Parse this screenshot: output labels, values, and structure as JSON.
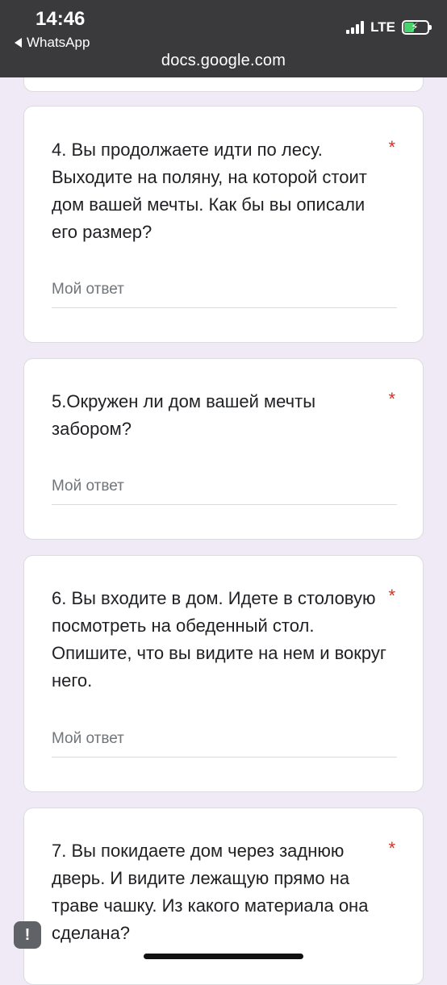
{
  "status_bar": {
    "time": "14:46",
    "back_label": "WhatsApp",
    "network": "LTE"
  },
  "browser": {
    "url": "docs.google.com"
  },
  "questions": [
    {
      "text": "4. Вы продолжаете идти по лесу. Выходите на поляну, на которой стоит дом вашей мечты. Как бы вы описали его размер?",
      "required_mark": "*",
      "answer_placeholder": "Мой ответ"
    },
    {
      "text": "5.Окружен ли дом вашей мечты забором?",
      "required_mark": "*",
      "answer_placeholder": "Мой ответ"
    },
    {
      "text": "6. Вы входите в дом. Идете в столовую посмотреть на обеденный стол. Опишите, что вы видите на нем и вокруг него.",
      "required_mark": "*",
      "answer_placeholder": "Мой ответ"
    },
    {
      "text": "7. Вы покидаете дом через заднюю дверь. И видите лежащую прямо на траве чашку. Из какого материала она сделана?",
      "required_mark": "*",
      "answer_placeholder": ""
    }
  ],
  "feedback_icon": "!"
}
